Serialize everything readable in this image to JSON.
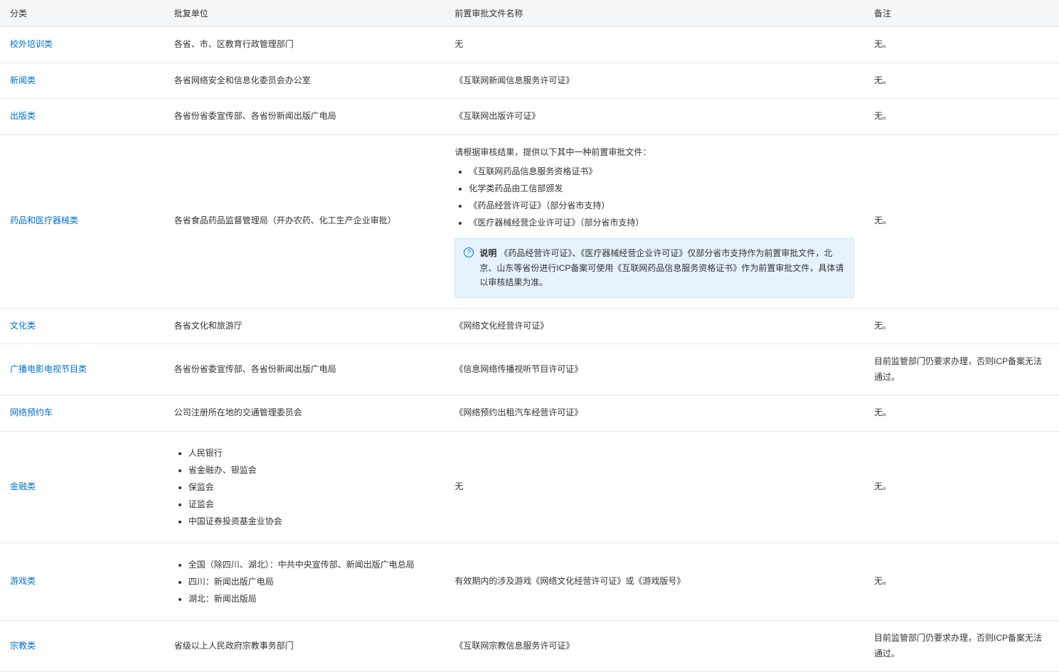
{
  "headers": {
    "category": "分类",
    "authority": "批复单位",
    "doc": "前置审批文件名称",
    "remark": "备注"
  },
  "rows": [
    {
      "category": "校外培训类",
      "authority_text": "各省、市、区教育行政管理部门",
      "doc_text": "无",
      "remark": "无。"
    },
    {
      "category": "新闻类",
      "authority_text": "各省网络安全和信息化委员会办公室",
      "doc_text": "《互联网新闻信息服务许可证》",
      "remark": "无。"
    },
    {
      "category": "出版类",
      "authority_text": "各省份省委宣传部、各省份新闻出版广电局",
      "doc_text": "《互联网出版许可证》",
      "remark": "无。"
    },
    {
      "category": "药品和医疗器械类",
      "authority_text": "各省食品药品监督管理局（开办农药、化工生产企业审批）",
      "doc_intro": "请根据审核结果，提供以下其中一种前置审批文件：",
      "doc_list": [
        "《互联网药品信息服务资格证书》",
        "化学类药品由工信部颁发",
        "《药品经营许可证》（部分省市支持）",
        "《医疗器械经营企业许可证》（部分省市支持）"
      ],
      "info_label": "说明",
      "info_text": "《药品经营许可证》、《医疗器械经营企业许可证》仅部分省市支持作为前置审批文件，北京、山东等省份进行ICP备案可使用《互联网药品信息服务资格证书》作为前置审批文件，具体请以审核结果为准。",
      "remark": "无。"
    },
    {
      "category": "文化类",
      "authority_text": "各省文化和旅游厅",
      "doc_text": "《网络文化经营许可证》",
      "remark": "无。"
    },
    {
      "category": "广播电影电视节目类",
      "authority_text": "各省份省委宣传部、各省份新闻出版广电局",
      "doc_text": "《信息网络传播视听节目许可证》",
      "remark": "目前监管部门仍要求办理，否则ICP备案无法通过。"
    },
    {
      "category": "网络预约车",
      "authority_text": "公司注册所在地的交通管理委员会",
      "doc_text": "《网络预约出租汽车经营许可证》",
      "remark": "无。"
    },
    {
      "category": "金融类",
      "authority_list": [
        "人民银行",
        "省金融办、银监会",
        "保监会",
        "证监会",
        "中国证券投资基金业协会"
      ],
      "doc_text": "无",
      "remark": "无。"
    },
    {
      "category": "游戏类",
      "authority_list": [
        "全国（除四川、湖北）：中共中央宣传部、新闻出版广电总局",
        "四川：新闻出版广电局",
        "湖北：新闻出版局"
      ],
      "doc_text": "有效期内的涉及游戏《网络文化经营许可证》或《游戏版号》",
      "remark": "无。"
    },
    {
      "category": "宗教类",
      "authority_text": "省级以上人民政府宗教事务部门",
      "doc_text": "《互联网宗教信息服务许可证》",
      "remark": "目前监管部门仍要求办理，否则ICP备案无法通过。"
    }
  ]
}
